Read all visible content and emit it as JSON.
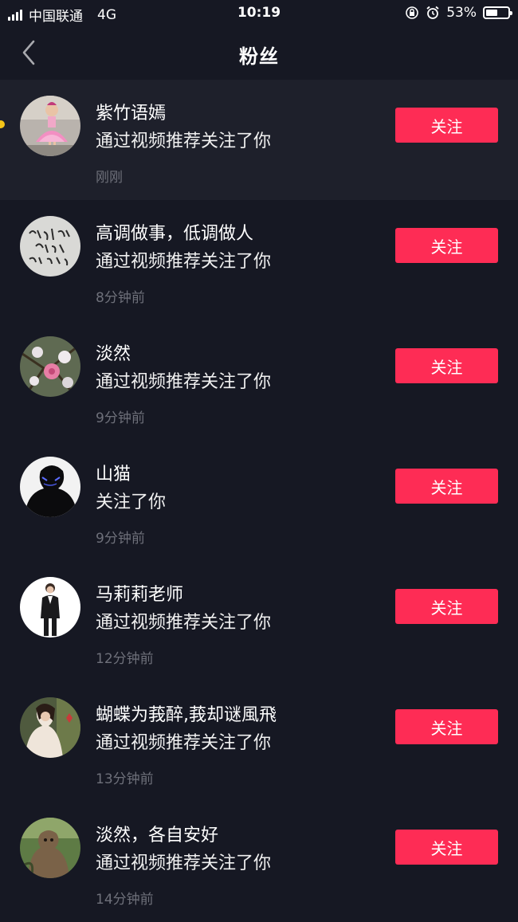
{
  "status_bar": {
    "carrier": "中国联通",
    "network": "4G",
    "time": "10:19",
    "battery": "53%",
    "battery_level": 0.53
  },
  "nav": {
    "title": "粉丝"
  },
  "colors": {
    "background": "#161823",
    "highlight_row": "#1e202b",
    "follow_button": "#fe2c55",
    "time_text": "#6e707a",
    "unread_dot": "#f5c518"
  },
  "followers": [
    {
      "name": "紫竹语嫣",
      "desc": "通过视频推荐关注了你",
      "time": "刚刚",
      "button": "关注",
      "avatar": "avatar-girl-pink-dress"
    },
    {
      "name": "高调做事，低调做人",
      "desc": "通过视频推荐关注了你",
      "time": "8分钟前",
      "button": "关注",
      "avatar": "avatar-calligraphy"
    },
    {
      "name": "淡然",
      "desc": "通过视频推荐关注了你",
      "time": "9分钟前",
      "button": "关注",
      "avatar": "avatar-flowers"
    },
    {
      "name": "山猫",
      "desc": "关注了你",
      "time": "9分钟前",
      "button": "关注",
      "avatar": "avatar-dark-mask"
    },
    {
      "name": "马莉莉老师",
      "desc": "通过视频推荐关注了你",
      "time": "12分钟前",
      "button": "关注",
      "avatar": "avatar-woman-suit"
    },
    {
      "name": "蝴蝶为莪醉,莪却谜風飛",
      "desc": "通过视频推荐关注了你",
      "time": "13分钟前",
      "button": "关注",
      "avatar": "avatar-woman-photo"
    },
    {
      "name": "淡然，各自安好",
      "desc": "通过视频推荐关注了你",
      "time": "14分钟前",
      "button": "关注",
      "avatar": "avatar-monkey"
    }
  ]
}
